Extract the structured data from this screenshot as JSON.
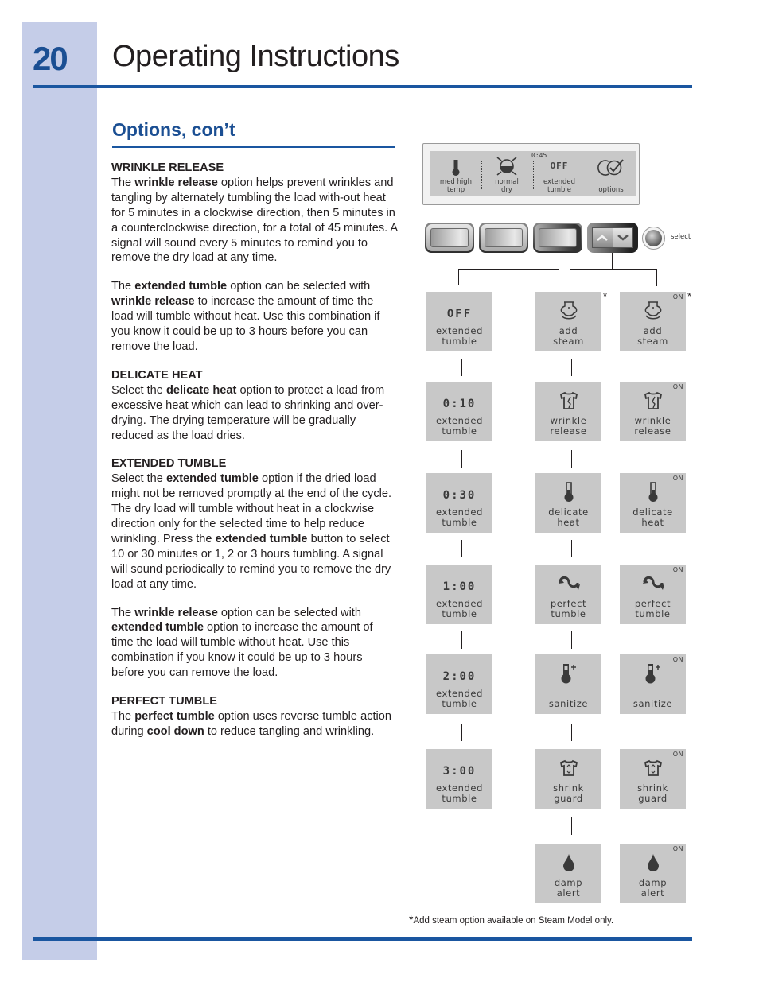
{
  "page": {
    "number": "20",
    "title": "Operating Instructions",
    "section_title": "Options, con’t",
    "accent_color": "#1a56a0",
    "band_color": "#c5cde8"
  },
  "text": {
    "wrinkle_head": "WRINKLE RELEASE",
    "wrinkle_p1": [
      "The ",
      "wrinkle release",
      " option helps prevent wrinkles and tangling by alternately tumbling the load with-out heat for 5 minutes in a clockwise direction, then 5 minutes in a counterclockwise direction, for a total of 45 minutes. A signal will sound every 5 minutes to remind you to remove the dry load at any time."
    ],
    "wrinkle_p2": [
      "The ",
      "extended tumble",
      " option can be selected with ",
      "wrinkle release",
      " to increase the amount of time the load will tumble without heat. Use this combination if you know it could be up to 3 hours before you can remove the load."
    ],
    "delicate_head": "DELICATE HEAT",
    "delicate_p1": [
      "Select the ",
      "delicate heat",
      " option to protect a load from excessive heat which can lead to shrinking and over-drying. The drying temperature will be gradually reduced as the load dries."
    ],
    "extended_head": "EXTENDED TUMBLE",
    "extended_p1": [
      "Select the ",
      "extended tumble",
      " option if the dried load might not be removed promptly at the end of the cycle. The dry load will tumble without heat in a clockwise direction only for the selected time to help reduce wrinkling. Press the ",
      "extended tumble",
      " button to select 10 or 30 minutes or 1, 2 or 3 hours tumbling. A signal will sound periodically to remind you to remove the dry load at any time."
    ],
    "extended_p2": [
      "The ",
      "wrinkle release",
      " option can be selected with ",
      "extended tumble",
      " option to increase the amount of time the load will tumble without heat. Use this combination if you know it could be up to 3 hours before you can remove the load."
    ],
    "perfect_head": "PERFECT TUMBLE",
    "perfect_p1": [
      "The ",
      "perfect tumble",
      " option uses reverse tumble action during ",
      "cool down",
      " to reduce tangling and wrinkling."
    ]
  },
  "display": {
    "time": "0:45",
    "cells": [
      {
        "icon": "thermometer-icon",
        "line1": "med high",
        "line2": "temp"
      },
      {
        "icon": "dryness-sun-icon",
        "line1": "normal",
        "line2": "dry"
      },
      {
        "big": "OFF",
        "line1": "extended",
        "line2": "tumble"
      },
      {
        "icon": "options-check-icon",
        "line1": "",
        "line2": "options"
      }
    ]
  },
  "controls": {
    "select_label": "select",
    "arrow_up": "up",
    "arrow_down": "down"
  },
  "extended_tumble_column": [
    {
      "value": "OFF",
      "line1": "extended",
      "line2": "tumble"
    },
    {
      "value": "0:10",
      "line1": "extended",
      "line2": "tumble"
    },
    {
      "value": "0:30",
      "line1": "extended",
      "line2": "tumble"
    },
    {
      "value": "1:00",
      "line1": "extended",
      "line2": "tumble"
    },
    {
      "value": "2:00",
      "line1": "extended",
      "line2": "tumble"
    },
    {
      "value": "3:00",
      "line1": "extended",
      "line2": "tumble"
    }
  ],
  "options_off_column": [
    {
      "icon": "steam-icon",
      "line1": "add",
      "line2": "steam",
      "asterisk": "*"
    },
    {
      "icon": "shirt-wrinkle-icon",
      "line1": "wrinkle",
      "line2": "release"
    },
    {
      "icon": "thermometer-icon",
      "line1": "delicate",
      "line2": "heat"
    },
    {
      "icon": "reverse-tumble-icon",
      "line1": "perfect",
      "line2": "tumble"
    },
    {
      "icon": "thermometer-plus-icon",
      "line1": "",
      "line2": "sanitize"
    },
    {
      "icon": "shirt-shrink-icon",
      "line1": "shrink",
      "line2": "guard"
    },
    {
      "icon": "water-drop-icon",
      "line1": "damp",
      "line2": "alert"
    }
  ],
  "options_on_column": [
    {
      "icon": "steam-icon",
      "line1": "add",
      "line2": "steam",
      "state": "ON",
      "asterisk": "*"
    },
    {
      "icon": "shirt-wrinkle-icon",
      "line1": "wrinkle",
      "line2": "release",
      "state": "ON"
    },
    {
      "icon": "thermometer-icon",
      "line1": "delicate",
      "line2": "heat",
      "state": "ON"
    },
    {
      "icon": "reverse-tumble-icon",
      "line1": "perfect",
      "line2": "tumble",
      "state": "ON"
    },
    {
      "icon": "thermometer-plus-icon",
      "line1": "",
      "line2": "sanitize",
      "state": "ON"
    },
    {
      "icon": "shirt-shrink-icon",
      "line1": "shrink",
      "line2": "guard",
      "state": "ON"
    },
    {
      "icon": "water-drop-icon",
      "line1": "damp",
      "line2": "alert",
      "state": "ON"
    }
  ],
  "footnote": {
    "asterisk": "*",
    "text": "Add steam option available on Steam Model only."
  }
}
